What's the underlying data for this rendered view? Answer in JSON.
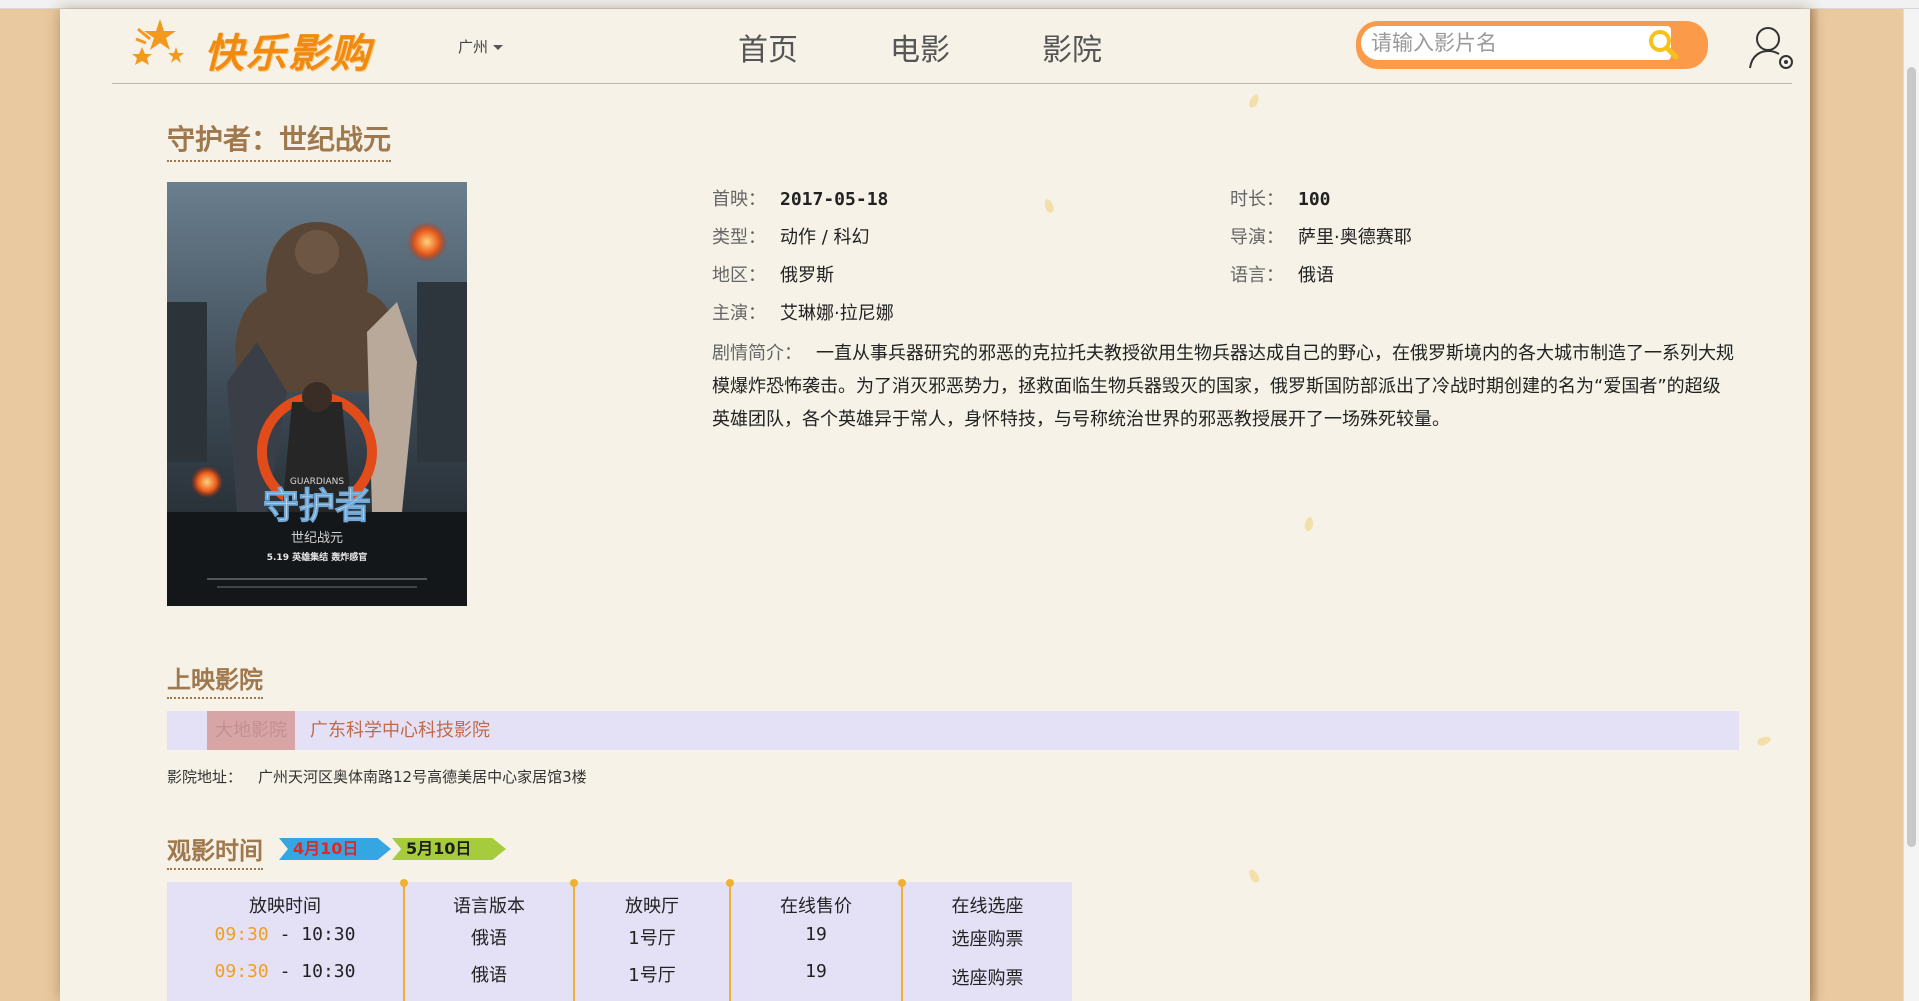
{
  "header": {
    "logo_text": "快乐影购",
    "city": "广州",
    "nav": [
      "首页",
      "电影",
      "影院"
    ],
    "search_placeholder": "请输入影片名"
  },
  "movie": {
    "title": "守护者：世纪战元",
    "premiere_label": "首映：",
    "premiere": "2017-05-18",
    "duration_label": "时长：",
    "duration": "100",
    "genre_label": "类型：",
    "genre": "动作 / 科幻",
    "director_label": "导演：",
    "director": "萨里·奥德赛耶",
    "region_label": "地区：",
    "region": "俄罗斯",
    "language_label": "语言：",
    "language": "俄语",
    "cast_label": "主演：",
    "cast": "艾琳娜·拉尼娜",
    "synopsis_label": "剧情简介：",
    "synopsis": "一直从事兵器研究的邪恶的克拉托夫教授欲用生物兵器达成自己的野心，在俄罗斯境内的各大城市制造了一系列大规模爆炸恐怖袭击。为了消灭邪恶势力，拯救面临生物兵器毁灭的国家，俄罗斯国防部派出了冷战时期创建的名为“爱国者”的超级英雄团队，各个英雄异于常人，身怀特技，与号称统治世界的邪恶教授展开了一场殊死较量。",
    "poster": {
      "en_title": "GUARDIANS",
      "cn_title": "守护者",
      "subtitle": "世纪战元",
      "tagline": "5.19 英雄集结 轰炸感官"
    }
  },
  "cinemas": {
    "title": "上映影院",
    "tag": "大地影院",
    "name": "广东科学中心科技影院",
    "address_label": "影院地址：",
    "address": "广州天河区奥体南路12号高德美居中心家居馆3楼"
  },
  "showtimes": {
    "title": "观影时间",
    "dates": [
      "4月10日",
      "5月10日"
    ],
    "headers": [
      "放映时间",
      "语言版本",
      "放映厅",
      "在线售价",
      "在线选座"
    ],
    "rows": [
      {
        "start": "09:30",
        "sep": "-",
        "end": "10:30",
        "language": "俄语",
        "hall": "1号厅",
        "price": "19",
        "action": "选座购票"
      },
      {
        "start": "09:30",
        "sep": "-",
        "end": "10:30",
        "language": "俄语",
        "hall": "1号厅",
        "price": "19",
        "action": "选座购票"
      }
    ]
  }
}
